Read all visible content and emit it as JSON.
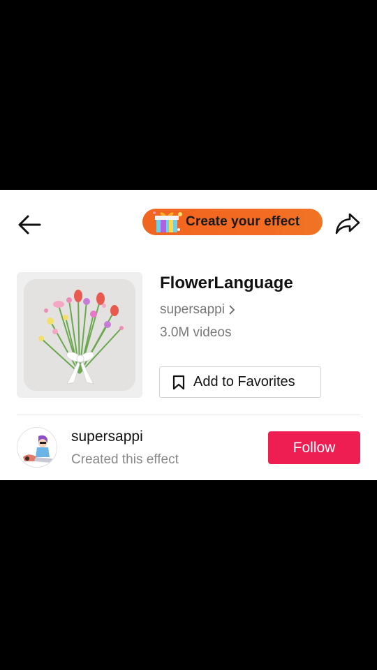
{
  "header": {
    "back_icon": "arrow-left-icon",
    "create_effect_label": "Create your effect",
    "gift_icon": "gift-box-icon",
    "share_icon": "share-arrow-icon"
  },
  "effect": {
    "name": "FlowerLanguage",
    "creator_link": "supersappi",
    "video_count": "3.0M videos",
    "thumbnail_icon": "flower-bouquet-thumbnail",
    "add_favorites_label": "Add to Favorites",
    "bookmark_icon": "bookmark-icon"
  },
  "creator": {
    "username": "supersappi",
    "subtitle": "Created this effect",
    "follow_label": "Follow",
    "avatar_icon": "user-avatar"
  },
  "colors": {
    "create_button": "#f36a22",
    "follow_button": "#ee1d52",
    "secondary_text": "#777777"
  }
}
